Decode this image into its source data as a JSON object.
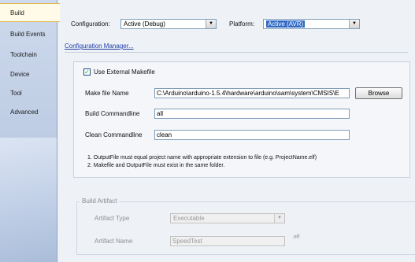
{
  "sidebar": {
    "items": [
      {
        "label": "Build"
      },
      {
        "label": "Build Events"
      },
      {
        "label": "Toolchain"
      },
      {
        "label": "Device"
      },
      {
        "label": "Tool"
      },
      {
        "label": "Advanced"
      }
    ]
  },
  "header": {
    "configuration_label": "Configuration:",
    "configuration_value": "Active (Debug)",
    "platform_label": "Platform:",
    "platform_value": "Active (AVR)"
  },
  "config_manager_link": "Configuration Manager...",
  "external_makefile": {
    "checkbox_label": "Use External Makefile",
    "checked": true,
    "make_file_label": "Make file Name",
    "make_file_value": "C:\\Arduino\\arduino-1.5.4\\hardware\\arduino\\sam\\system\\CMSIS\\E",
    "browse_label": "Browse",
    "build_cmd_label": "Build Commandline",
    "build_cmd_value": "all",
    "clean_cmd_label": "Clean Commandline",
    "clean_cmd_value": "clean",
    "note1": "1. OutputFile must equal project name with appropriate extension to file (e.g. ProjectName.elf)",
    "note2": "2. Makefile and OutputFile must exist in the same folder."
  },
  "build_artifact": {
    "legend": "Build Artifact",
    "type_label": "Artifact Type",
    "type_value": "Executable",
    "name_label": "Artifact Name",
    "name_value": "SpeedTest",
    "ext": ".elf"
  },
  "icons": {
    "dropdown": "▼",
    "check": "✓"
  }
}
